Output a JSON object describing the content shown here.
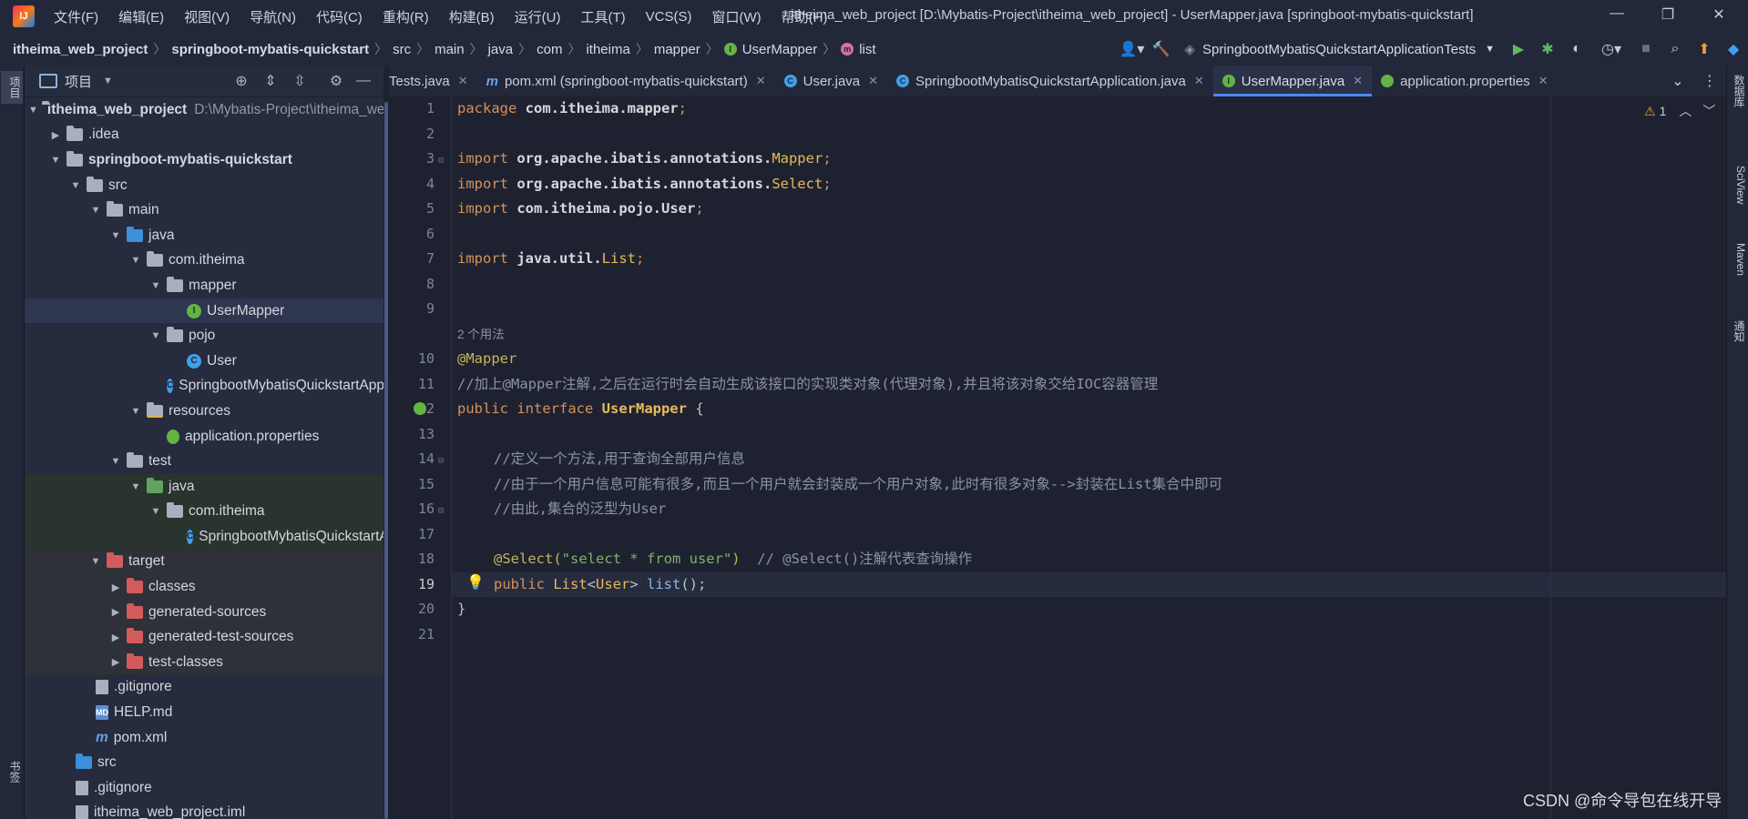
{
  "menubar": {
    "logo_text": "IJ",
    "items": [
      "文件(F)",
      "编辑(E)",
      "视图(V)",
      "导航(N)",
      "代码(C)",
      "重构(R)",
      "构建(B)",
      "运行(U)",
      "工具(T)",
      "VCS(S)",
      "窗口(W)",
      "帮助(H)"
    ],
    "window_title": "itheima_web_project [D:\\Mybatis-Project\\itheima_web_project] - UserMapper.java [springboot-mybatis-quickstart]",
    "controls": {
      "minimize": "—",
      "restore": "❐",
      "close": "✕"
    }
  },
  "navbar": {
    "crumbs": [
      "itheima_web_project",
      "springboot-mybatis-quickstart",
      "src",
      "main",
      "java",
      "com",
      "itheima",
      "mapper",
      "UserMapper",
      "list"
    ],
    "run_config": "SpringbootMybatisQuickstartApplicationTests"
  },
  "left_strip": {
    "project_tab": "项目",
    "bookmarks_tab": "书签"
  },
  "project_panel": {
    "title": "项目",
    "tree": [
      {
        "label": "itheima_web_project",
        "sub": "D:\\Mybatis-Project\\itheima_web_project",
        "bold": true
      },
      {
        "label": ".idea"
      },
      {
        "label": "springboot-mybatis-quickstart",
        "bold": true
      },
      {
        "label": "src"
      },
      {
        "label": "main"
      },
      {
        "label": "java"
      },
      {
        "label": "com.itheima"
      },
      {
        "label": "mapper"
      },
      {
        "label": "UserMapper"
      },
      {
        "label": "pojo"
      },
      {
        "label": "User"
      },
      {
        "label": "SpringbootMybatisQuickstartApplication"
      },
      {
        "label": "resources"
      },
      {
        "label": "application.properties"
      },
      {
        "label": "test"
      },
      {
        "label": "java"
      },
      {
        "label": "com.itheima"
      },
      {
        "label": "SpringbootMybatisQuickstartApplicationTests"
      },
      {
        "label": "target"
      },
      {
        "label": "classes"
      },
      {
        "label": "generated-sources"
      },
      {
        "label": "generated-test-sources"
      },
      {
        "label": "test-classes"
      },
      {
        "label": ".gitignore"
      },
      {
        "label": "HELP.md"
      },
      {
        "label": "pom.xml"
      },
      {
        "label": "src"
      },
      {
        "label": ".gitignore"
      },
      {
        "label": "itheima_web_project.iml"
      }
    ]
  },
  "tabs": [
    {
      "label": "Tests.java"
    },
    {
      "label": "pom.xml (springboot-mybatis-quickstart)"
    },
    {
      "label": "User.java"
    },
    {
      "label": "SpringbootMybatisQuickstartApplication.java"
    },
    {
      "label": "UserMapper.java"
    },
    {
      "label": "application.properties"
    }
  ],
  "editor": {
    "inspection_count": "1",
    "usage_hint": "2 个用法",
    "line_numbers": [
      "1",
      "2",
      "3",
      "4",
      "5",
      "6",
      "7",
      "8",
      "9",
      "10",
      "11",
      "12",
      "13",
      "14",
      "15",
      "16",
      "17",
      "18",
      "19",
      "20",
      "21"
    ],
    "code": {
      "l1_kw": "package",
      "l1_pkg": "com.itheima.mapper",
      "l1_end": ";",
      "l3_kw": "import",
      "l3_pkg": "org.apache.ibatis.annotations.",
      "l3_cls": "Mapper",
      "l3_end": ";",
      "l4_kw": "import",
      "l4_pkg": "org.apache.ibatis.annotations.",
      "l4_cls": "Select",
      "l4_end": ";",
      "l5_kw": "import",
      "l5_pkg": "com.itheima.pojo.User",
      "l5_end": ";",
      "l7_kw": "import",
      "l7_pkg": "java.util.",
      "l7_cls": "List",
      "l7_end": ";",
      "l10": "@Mapper",
      "l11": "//加上@Mapper注解,之后在运行时会自动生成该接口的实现类对象(代理对象),并且将该对象交给IOC容器管理",
      "l12_kw": "public interface",
      "l12_cls": "UserMapper",
      "l12_end": " {",
      "l14": "//定义一个方法,用于查询全部用户信息",
      "l15": "//由于一个用户信息可能有很多,而且一个用户就会封装成一个用户对象,此时有很多对象-->封装在List集合中即可",
      "l16": "//由此,集合的泛型为User",
      "l18_ann": "@Select(",
      "l18_str": "\"select * from user\"",
      "l18_ann2": ")",
      "l18_cmt": "  // @Select()注解代表查询操作",
      "l19_kw": "public",
      "l19_ty": "List",
      "l19_lt": "<",
      "l19_ty2": "User",
      "l19_gt": "> ",
      "l19_fn": "list",
      "l19_end": "();",
      "l20": "}"
    }
  },
  "right_strip": [
    "数据库",
    "SciView",
    "Maven",
    "通知"
  ],
  "watermark": "CSDN @命令导包在线开导"
}
